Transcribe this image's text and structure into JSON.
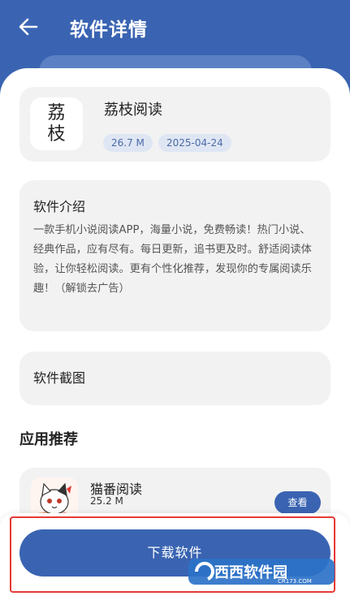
{
  "header": {
    "title": "软件详情",
    "back_icon": "arrow-left-icon"
  },
  "app": {
    "icon_chars": [
      "荔",
      "枝"
    ],
    "name": "荔枝阅读",
    "size": "26.7 M",
    "date": "2025-04-24"
  },
  "intro": {
    "title": "软件介绍",
    "text": "一款手机小说阅读APP，海量小说，免费畅读！热门小说、经典作品，应有尽有。每日更新，追书更及时。舒适阅读体验，让你轻松阅读。更有个性化推荐，发现你的专属阅读乐趣！（解锁去广告）"
  },
  "screenshots": {
    "title": "软件截图"
  },
  "recommend": {
    "title": "应用推荐",
    "items": [
      {
        "name": "猫番阅读",
        "size": "25.2 M",
        "action": "查看"
      }
    ]
  },
  "download": {
    "label": "下载软件"
  },
  "watermark": {
    "text": "西西软件园",
    "url": "CR173.COM"
  },
  "colors": {
    "brand": "#3a64b2",
    "card_bg": "#f2f2f2",
    "badge_bg": "#dfe6f3",
    "highlight": "#e53935"
  }
}
